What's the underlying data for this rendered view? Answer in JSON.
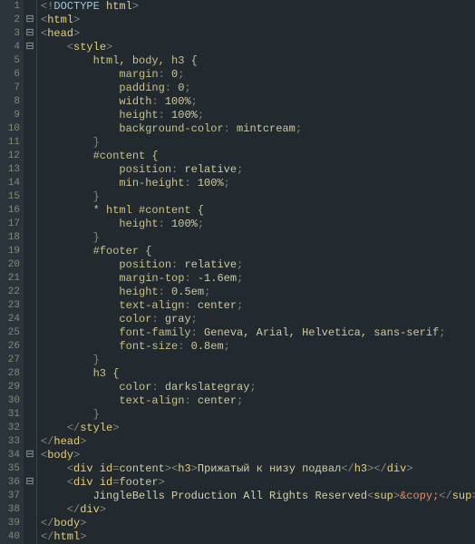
{
  "lineCount": 40,
  "fold": {
    "minus": [
      2,
      3,
      4,
      34,
      36
    ],
    "plain": [
      5,
      6,
      7,
      8,
      9,
      10,
      11,
      12,
      13,
      14,
      15,
      16,
      17,
      18,
      19,
      20,
      21,
      22,
      23,
      24,
      25,
      26,
      27,
      28,
      29,
      30,
      31,
      32,
      33,
      35,
      37,
      38,
      39,
      40
    ]
  },
  "code": {
    "l1": {
      "doctype": "DOCTYPE",
      "rest": " html"
    },
    "l2": {
      "tag": "html"
    },
    "l3": {
      "tag": "head"
    },
    "l4": {
      "tag": "style"
    },
    "l5": {
      "sel": "html, body, h3 {"
    },
    "l6": {
      "prop": "margin",
      "val": "0"
    },
    "l7": {
      "prop": "padding",
      "val": "0"
    },
    "l8": {
      "prop": "width",
      "val": "100%"
    },
    "l9": {
      "prop": "height",
      "val": "100%"
    },
    "l10": {
      "prop": "background-color",
      "val": "mintcream"
    },
    "l11": {
      "brace": "}"
    },
    "l12": {
      "sel": "#content {"
    },
    "l13": {
      "prop": "position",
      "val": "relative"
    },
    "l14": {
      "prop": "min-height",
      "val": "100%"
    },
    "l15": {
      "brace": "}"
    },
    "l16": {
      "sel": "* html #content {"
    },
    "l17": {
      "prop": "height",
      "val": "100%"
    },
    "l18": {
      "brace": "}"
    },
    "l19": {
      "sel": "#footer {"
    },
    "l20": {
      "prop": "position",
      "val": "relative"
    },
    "l21": {
      "prop": "margin-top",
      "val": "-1.6em"
    },
    "l22": {
      "prop": "height",
      "val": "0.5em"
    },
    "l23": {
      "prop": "text-align",
      "val": "center"
    },
    "l24": {
      "prop": "color",
      "val": "gray"
    },
    "l25": {
      "prop": "font-family",
      "val": "Geneva, Arial, Helvetica, sans-serif"
    },
    "l26": {
      "prop": "font-size",
      "val": "0.8em"
    },
    "l27": {
      "brace": "}"
    },
    "l28": {
      "sel": "h3 {"
    },
    "l29": {
      "prop": "color",
      "val": "darkslategray"
    },
    "l30": {
      "prop": "text-align",
      "val": "center"
    },
    "l31": {
      "brace": "}"
    },
    "l32": {
      "closeTag": "style"
    },
    "l33": {
      "closeTag": "head"
    },
    "l34": {
      "tag": "body"
    },
    "l35": {
      "openTag": "div",
      "attr": "id",
      "attrVal": "content",
      "innerOpen": "h3",
      "text": "Прижатый к низу подвал",
      "innerClose": "h3",
      "closeTag": "div"
    },
    "l36": {
      "openTag": "div",
      "attr": "id",
      "attrVal": "footer"
    },
    "l37": {
      "text": "JingleBells Production All Rights Reserved",
      "supOpen": "sup",
      "entity": "&copy;",
      "supClose": "sup"
    },
    "l38": {
      "closeTag": "div"
    },
    "l39": {
      "closeTag": "body"
    },
    "l40": {
      "closeTag": "html"
    }
  }
}
